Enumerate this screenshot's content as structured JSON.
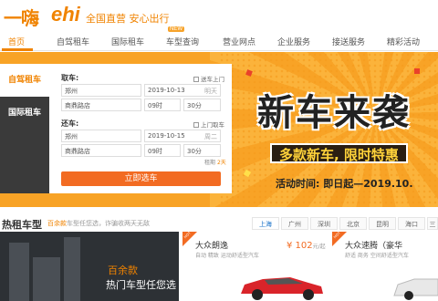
{
  "header": {
    "logo_cn": "一嗨",
    "logo_en": "ehi",
    "slogan": "全国直营 安心出行"
  },
  "nav": {
    "items": [
      {
        "label": "首页",
        "active": true
      },
      {
        "label": "自驾租车"
      },
      {
        "label": "国际租车"
      },
      {
        "label": "车型查询",
        "badge": "NEW"
      },
      {
        "label": "营业网点"
      },
      {
        "label": "企业服务"
      },
      {
        "label": "接送服务"
      },
      {
        "label": "精彩活动"
      }
    ]
  },
  "side_tabs": [
    "自驾租车",
    "国际租车"
  ],
  "booking": {
    "pickup_label": "取车:",
    "pickup_city": "郑州",
    "pickup_store": "商鼎路店",
    "pickup_date": "2019-10-13",
    "pickup_weekday": "明天",
    "pickup_hour": "09时",
    "pickup_minute": "30分",
    "pickup_delivery": "送车上门",
    "return_label": "还车:",
    "return_city": "郑州",
    "return_store": "商鼎路店",
    "return_date": "2019-10-15",
    "return_weekday": "周二",
    "return_hour": "09时",
    "return_minute": "30分",
    "return_delivery": "上门取车",
    "rent_days_label": "租期",
    "rent_days_value": "2天",
    "submit": "立即选车"
  },
  "banner": {
    "title": "新车来袭",
    "subtitle": "多款新车, 限时特惠",
    "date": "活动时间: 即日起—2019.10."
  },
  "hot": {
    "title": "热租车型",
    "sub_highlight": "百余款",
    "sub_text": "车型任您选，诈骗收两天无敌",
    "cities": [
      "上海",
      "广州",
      "深圳",
      "北京",
      "昆明",
      "海口",
      "三"
    ],
    "active_city": "上海",
    "promo_line1": "百余款",
    "promo_line2": "热门车型任您选",
    "cars": [
      {
        "name": "大众朗逸",
        "desc": "自动 精致 运动舒适型汽车",
        "price": "¥ 102",
        "unit": "元/起"
      },
      {
        "name": "大众速腾（豪华",
        "desc": "舒适 商务 空间舒适型汽车",
        "price": "",
        "unit": ""
      }
    ]
  },
  "colors": {
    "accent": "#f08300",
    "button": "#f26b22",
    "banner_bg": "#f8a326"
  }
}
